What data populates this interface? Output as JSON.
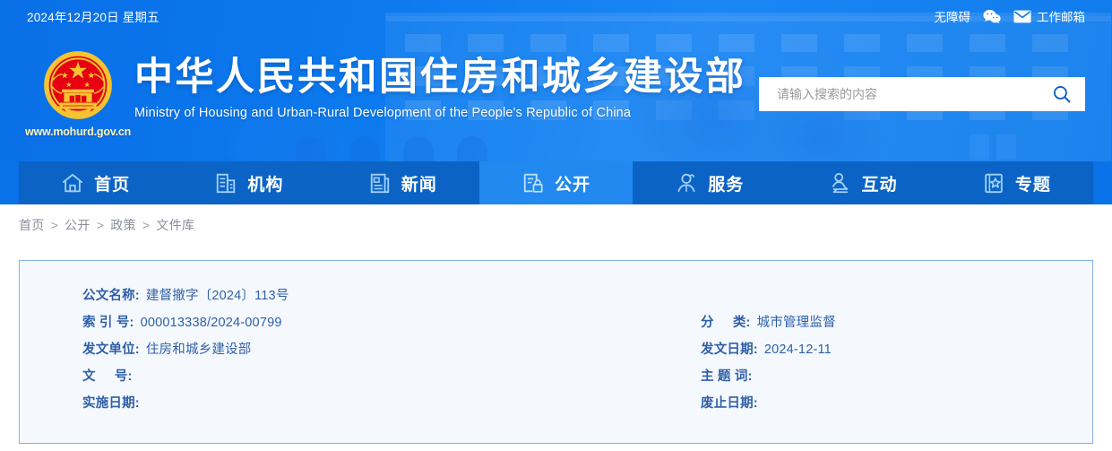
{
  "topbar": {
    "date": "2024年12月20日 星期五",
    "accessibility_label": "无障碍",
    "wechat_icon": "wechat-icon",
    "mail_icon": "envelope-icon",
    "work_mail_label": "工作邮箱"
  },
  "brand": {
    "emblem_icon": "china-national-emblem",
    "site_url": "www.mohurd.gov.cn",
    "title_cn": "中华人民共和国住房和城乡建设部",
    "title_en": "Ministry of Housing and Urban-Rural Development of the People's Republic of China"
  },
  "search": {
    "placeholder": "请输入搜索的内容",
    "value": "",
    "icon": "search-icon"
  },
  "nav": {
    "items": [
      {
        "label": "首页",
        "icon": "home-icon",
        "active": false
      },
      {
        "label": "机构",
        "icon": "building-icon",
        "active": false
      },
      {
        "label": "新闻",
        "icon": "news-document-icon",
        "active": false
      },
      {
        "label": "公开",
        "icon": "document-lock-icon",
        "active": true
      },
      {
        "label": "服务",
        "icon": "person-service-icon",
        "active": false
      },
      {
        "label": "互动",
        "icon": "person-exchange-icon",
        "active": false
      },
      {
        "label": "专题",
        "icon": "star-frame-icon",
        "active": false
      }
    ]
  },
  "breadcrumb": {
    "separator": ">",
    "items": [
      "首页",
      "公开",
      "政策",
      "文件库"
    ]
  },
  "doc_info": {
    "rows": [
      {
        "left_label": "公文名称:",
        "left_value": "建督撤字〔2024〕113号",
        "right_label": "",
        "right_value": ""
      },
      {
        "left_label": "索 引 号:",
        "left_value": "000013338/2024-00799",
        "right_label": "分     类:",
        "right_value": "城市管理监督"
      },
      {
        "left_label": "发文单位:",
        "left_value": "住房和城乡建设部",
        "right_label": "发文日期:",
        "right_value": "2024-12-11"
      },
      {
        "left_label": "文     号:",
        "left_value": "",
        "right_label": "主 题 词:",
        "right_value": ""
      },
      {
        "left_label": "实施日期:",
        "left_value": "",
        "right_label": "废止日期:",
        "right_value": ""
      }
    ]
  },
  "colors": {
    "header_blue": "#0a72e8",
    "nav_blue": "#0b63c5",
    "nav_active_blue": "#2189ef",
    "panel_bg": "#f5f9fe",
    "panel_border": "#83aee6",
    "label_text": "#2f5fa8",
    "url_yellow": "#fdf3c2"
  }
}
